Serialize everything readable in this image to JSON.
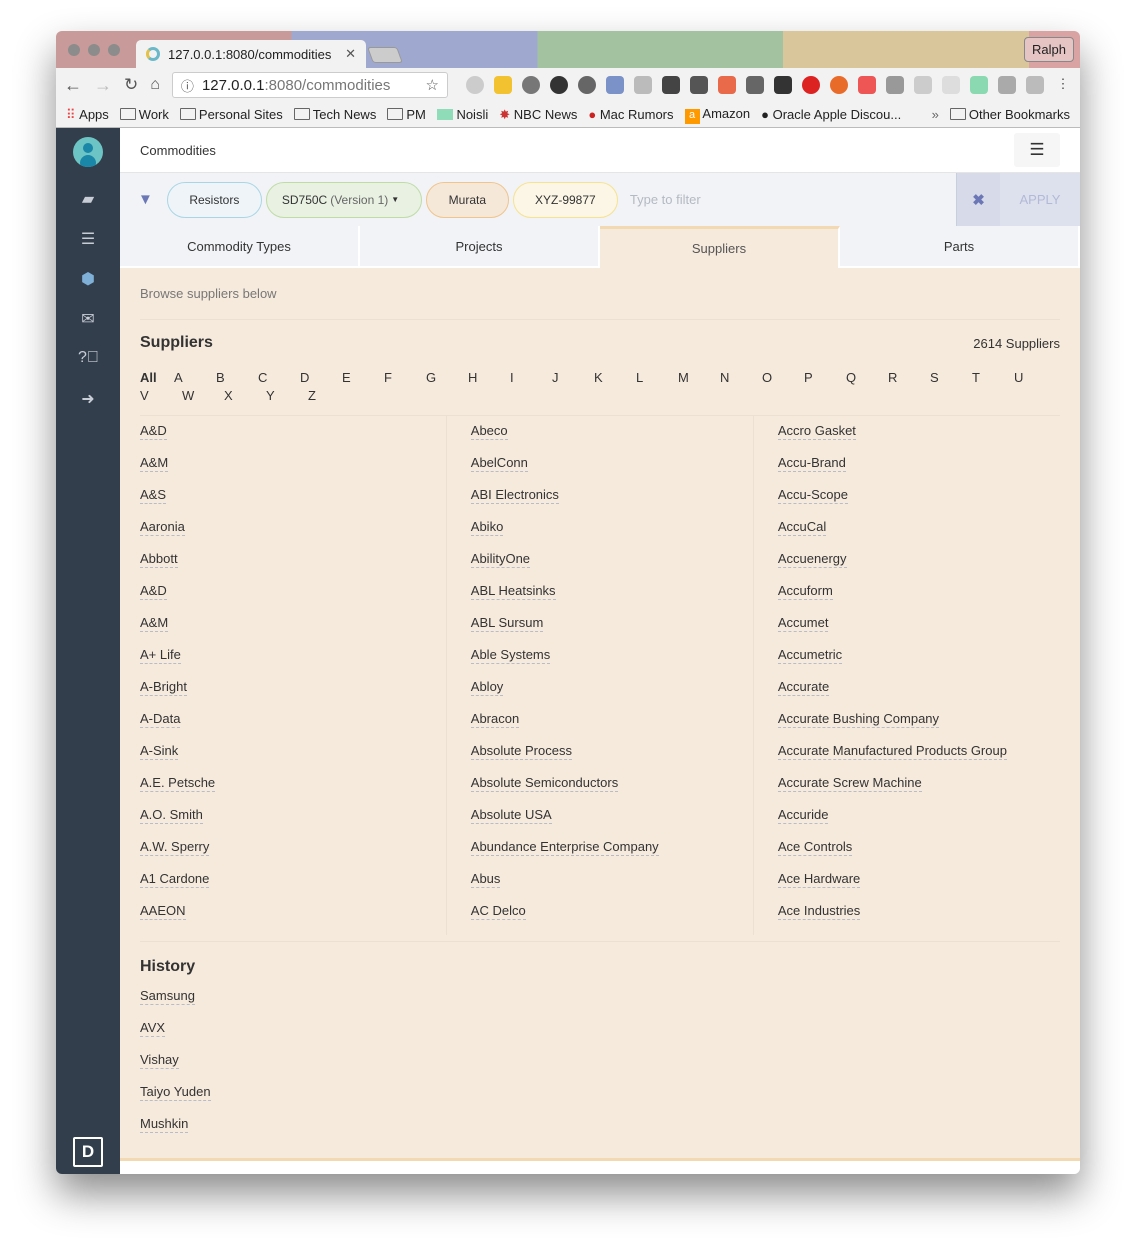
{
  "browser": {
    "tab_title": "127.0.0.1:8080/commodities",
    "url_host": "127.0.0.1",
    "url_path": ":8080/commodities",
    "profile": "Ralph",
    "bookmarks": [
      "Apps",
      "Work",
      "Personal Sites",
      "Tech News",
      "PM",
      "Noisli",
      "NBC News",
      "Mac Rumors",
      "Amazon",
      "Oracle Apple Discou...",
      "Other Bookmarks"
    ],
    "more": "»"
  },
  "header": {
    "title": "Commodities"
  },
  "filter": {
    "chips": [
      "Resistors",
      "SD750C",
      "(Version 1)",
      "Murata",
      "XYZ-99877"
    ],
    "placeholder": "Type to filter",
    "apply": "APPLY",
    "clear": "✖"
  },
  "tabs": [
    "Commodity Types",
    "Projects",
    "Suppliers",
    "Parts"
  ],
  "active_tab": "Suppliers",
  "content": {
    "subtitle": "Browse suppliers below",
    "title": "Suppliers",
    "count": "2614 Suppliers",
    "letters": [
      "All",
      "A",
      "B",
      "C",
      "D",
      "E",
      "F",
      "G",
      "H",
      "I",
      "J",
      "K",
      "L",
      "M",
      "N",
      "O",
      "P",
      "Q",
      "R",
      "S",
      "T",
      "U",
      "V",
      "W",
      "X",
      "Y",
      "Z"
    ],
    "columns": [
      [
        "A&D",
        "A&M",
        "A&S",
        "Aaronia",
        "Abbott",
        "A&D",
        "A&M",
        "A+ Life",
        "A-Bright",
        "A-Data",
        "A-Sink",
        "A.E. Petsche",
        "A.O. Smith",
        "A.W. Sperry",
        "A1 Cardone",
        "AAEON"
      ],
      [
        "Abeco",
        "AbelConn",
        "ABI Electronics",
        "Abiko",
        "AbilityOne",
        "ABL Heatsinks",
        "ABL Sursum",
        "Able Systems",
        "Abloy",
        "Abracon",
        "Absolute Process",
        "Absolute Semiconductors",
        "Absolute USA",
        "Abundance Enterprise Company",
        "Abus",
        "AC Delco"
      ],
      [
        "Accro Gasket",
        "Accu-Brand",
        "Accu-Scope",
        "AccuCal",
        "Accuenergy",
        "Accuform",
        "Accumet",
        "Accumetric",
        "Accurate",
        "Accurate Bushing Company",
        "Accurate Manufactured Products Group",
        "Accurate Screw Machine",
        "Accuride",
        "Ace Controls",
        "Ace Hardware",
        "Ace Industries"
      ]
    ]
  },
  "history": {
    "title": "History",
    "items": [
      "Samsung",
      "AVX",
      "Vishay",
      "Taiyo Yuden",
      "Mushkin"
    ]
  },
  "logo": "D"
}
